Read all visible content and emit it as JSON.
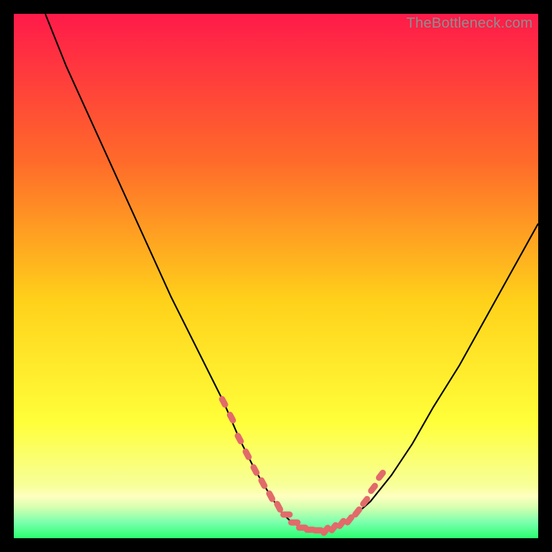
{
  "watermark": "TheBottleneck.com",
  "colors": {
    "gradient_top": "#ff1a4a",
    "gradient_mid1": "#ff6a2a",
    "gradient_mid2": "#ffd21a",
    "gradient_mid3": "#ffff3a",
    "gradient_bottom_band": "#f7ff9a",
    "gradient_green": "#2aff70",
    "line": "#000000",
    "marker": "#e26a6a"
  },
  "chart_data": {
    "type": "line",
    "title": "",
    "xlabel": "",
    "ylabel": "",
    "xlim": [
      0,
      100
    ],
    "ylim": [
      0,
      100
    ],
    "series": [
      {
        "name": "bottleneck-curve",
        "x": [
          6,
          10,
          15,
          20,
          25,
          30,
          35,
          40,
          43,
          46,
          49,
          51,
          53,
          55,
          57,
          59,
          61,
          64,
          68,
          72,
          76,
          80,
          85,
          90,
          95,
          100
        ],
        "y": [
          100,
          90,
          79,
          68,
          57,
          46,
          36,
          26,
          19,
          13,
          8,
          5,
          3,
          2,
          1.5,
          1.5,
          2,
          3.5,
          7,
          12,
          18,
          25,
          33,
          42,
          51,
          60
        ]
      }
    ],
    "markers": {
      "name": "highlighted-range",
      "x": [
        40,
        41.5,
        43,
        44.5,
        46,
        47.5,
        49,
        50.5,
        52,
        53.5,
        55,
        56.5,
        58,
        59.5,
        61,
        62.5,
        64,
        65.5,
        67,
        68.5,
        70
      ],
      "y": [
        26,
        23,
        19,
        16,
        13,
        10.5,
        8,
        6,
        4.5,
        3,
        2,
        1.6,
        1.5,
        1.5,
        2,
        2.8,
        3.5,
        5,
        7,
        9.5,
        12
      ]
    }
  }
}
